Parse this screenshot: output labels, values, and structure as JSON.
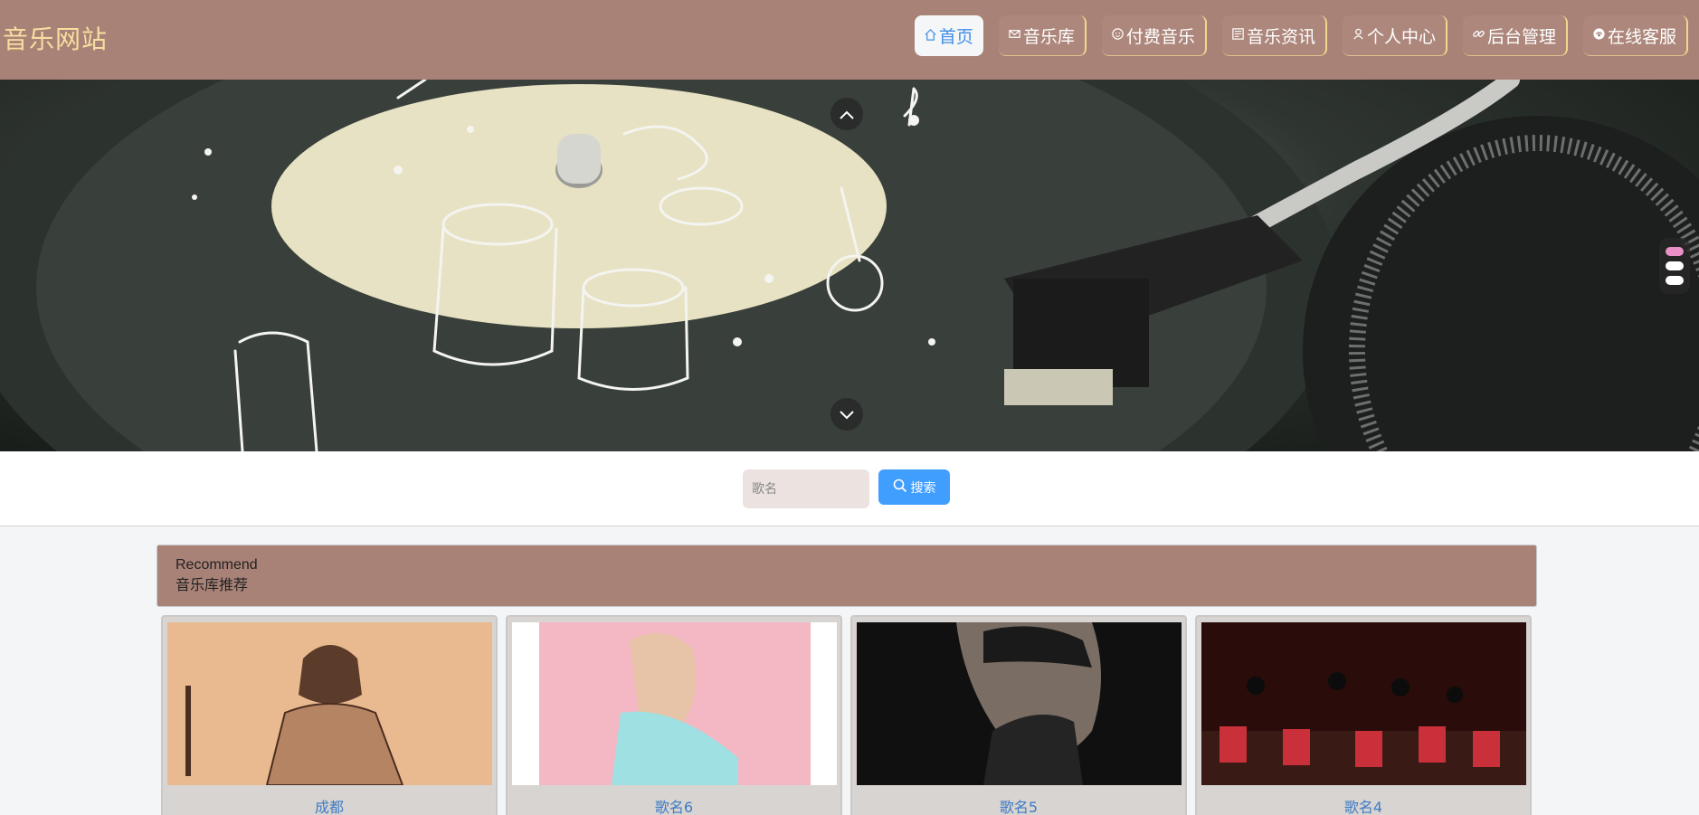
{
  "header": {
    "logo": "音乐网站",
    "nav": [
      {
        "label": "首页",
        "icon": "home-icon",
        "active": true
      },
      {
        "label": "音乐库",
        "icon": "mail-icon"
      },
      {
        "label": "付费音乐",
        "icon": "smile-icon"
      },
      {
        "label": "音乐资讯",
        "icon": "news-icon"
      },
      {
        "label": "个人中心",
        "icon": "user-icon"
      },
      {
        "label": "后台管理",
        "icon": "link-icon"
      },
      {
        "label": "在线客服",
        "icon": "support-icon"
      }
    ]
  },
  "banner": {
    "prev_icon": "chevron-up-icon",
    "next_icon": "chevron-down-icon",
    "indicators": 3,
    "active_indicator": 1
  },
  "search": {
    "placeholder": "歌名",
    "value": "",
    "button_label": "搜索",
    "button_icon": "search-icon"
  },
  "recommend": {
    "title_en": "Recommend",
    "title_cn": "音乐库推荐",
    "items": [
      {
        "title": "成都"
      },
      {
        "title": "歌名6"
      },
      {
        "title": "歌名5"
      },
      {
        "title": "歌名4"
      }
    ]
  },
  "colors": {
    "header_bg": "#a98277",
    "logo": "#f6dfa0",
    "accent_blue": "#409eff",
    "link_blue": "#3f7cc4",
    "indicator_active": "#ea8fc7"
  }
}
